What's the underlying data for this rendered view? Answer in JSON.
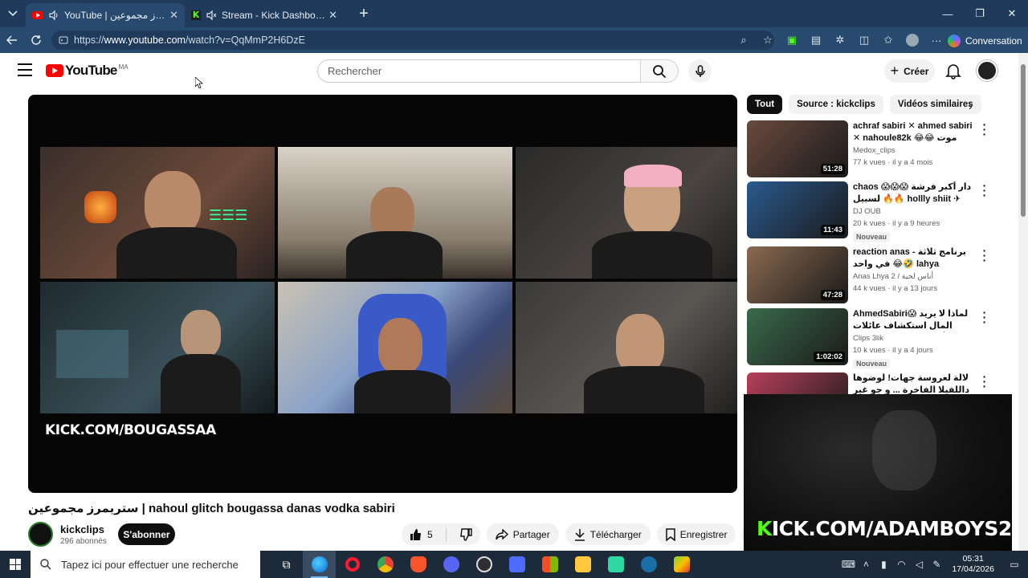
{
  "browser": {
    "tabs": [
      {
        "title": "YouTube | ستريمرز مجموعين",
        "active": true
      },
      {
        "title": "Stream - Kick Dashboard",
        "active": false
      }
    ],
    "url_scheme": "https://",
    "url_host": "www.youtube.com",
    "url_path": "/watch?v=QqMmP2H6DzE",
    "conversation_label": "Conversation"
  },
  "youtube": {
    "logo_text": "YouTube",
    "region": "MA",
    "search_placeholder": "Rechercher",
    "create_label": "Créer"
  },
  "video": {
    "overlay_url": "KICK.COM/BOUGASSAA",
    "title": "ستريمرز مجموعين | nahoul glitch bougassa danas vodka sabiri",
    "channel": "kickclips",
    "subscribers": "296 abonnés",
    "subscribe_label": "S'abonner",
    "likes": "5",
    "share_label": "Partager",
    "download_label": "Télécharger",
    "save_label": "Enregistrer"
  },
  "sidebar": {
    "chips": [
      "Tout",
      "Source : kickclips",
      "Vidéos similaires"
    ],
    "recommendations": [
      {
        "title": "achraf sabiri ✕ ahmed sabiri ✕ nahoule82k 😂😂 موت ديال الضحك...",
        "channel": "Medox_clips",
        "meta": "77 k vues · il y a 4 mois",
        "duration": "51:28",
        "badge": "",
        "thumb_color": "#6a4a3e"
      },
      {
        "title": "chaos 😱😱😱 دار أكبر فرشة لسبيل 🔥🔥 hollly shiit ✈#kick ...",
        "channel": "DJ OUB",
        "meta": "20 k vues · il y a 9 heures",
        "duration": "11:43",
        "badge": "Nouveau",
        "thumb_color": "#2a5a8f"
      },
      {
        "title": "reaction anas - برنامج ثلاثة في واحد 😂🤣 lahya",
        "channel": "Anas Lhya 2 / أناس لحية",
        "meta": "44 k vues · il y a 13 jours",
        "duration": "47:28",
        "badge": "",
        "thumb_color": "#8a6a4f"
      },
      {
        "title": "AhmedSabiri😱 لماذا لا يريد المال استكشاف عائلات الأمازون؟ الجواب صادم!",
        "channel": "Clips 3lik",
        "meta": "10 k vues · il y a 4 jours",
        "duration": "1:02:02",
        "badge": "Nouveau",
        "thumb_color": "#3a6a4a"
      },
      {
        "title": "لالة لعروسة جهات! لوضوها داللفيلا الفاخرة ... و جو غير هو قداه لعريس",
        "channel": "",
        "meta": "",
        "duration": "",
        "badge": "",
        "thumb_color": "#b8405a"
      }
    ]
  },
  "overlay": {
    "text_k": "K",
    "text_rest": "ICK.COM/ADAMBOYS2"
  },
  "taskbar": {
    "search_placeholder": "Tapez ici pour effectuer une recherche",
    "time": "05:31",
    "date": "17/04/2026"
  },
  "colors": {
    "browser_tabbar": "#1f3a5a",
    "browser_addrbar": "#294a6f",
    "youtube_red": "#ff0000",
    "kick_green": "#53fc18",
    "taskbar": "#1c2a3a"
  }
}
